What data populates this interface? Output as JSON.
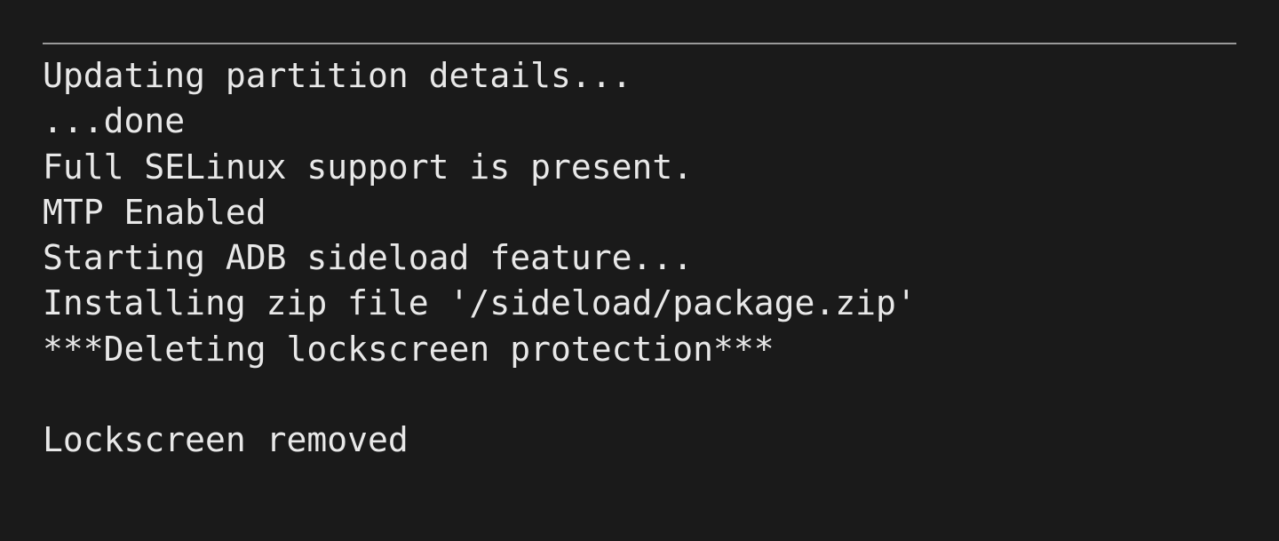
{
  "log": {
    "lines": [
      "Updating partition details...",
      "...done",
      "Full SELinux support is present.",
      "MTP Enabled",
      "Starting ADB sideload feature...",
      "Installing zip file '/sideload/package.zip'",
      "***Deleting lockscreen protection***",
      "",
      "Lockscreen removed"
    ]
  }
}
